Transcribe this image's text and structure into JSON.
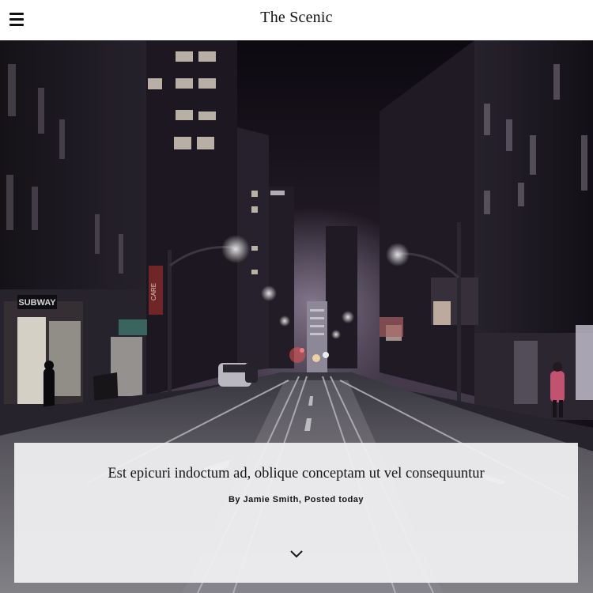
{
  "header": {
    "menu_icon": "hamburger-menu-icon",
    "site_title": "The Scenic"
  },
  "hero": {
    "image": "night-city-street-photo",
    "storefront_sign": "SUBWAY",
    "banner_text": "CARE"
  },
  "post": {
    "title": "Est epicuri indoctum ad, oblique conceptam ut vel consequuntur",
    "byline": "By Jamie Smith, Posted today",
    "scroll_icon": "chevron-down-icon"
  },
  "colors": {
    "header_bg": "#ffffff",
    "card_bg": "#f0f0f2",
    "text": "#111111",
    "night_sky": "#1b1520"
  }
}
